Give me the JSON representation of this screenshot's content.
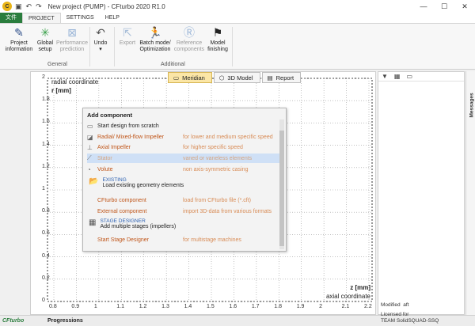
{
  "window": {
    "app_icon": "C",
    "title": "New project (PUMP) - CFturbo 2020 R1.0",
    "controls": [
      "minimize-icon",
      "maximize-icon",
      "close-icon"
    ]
  },
  "quick_access": [
    "save-icon",
    "undo-icon",
    "redo-icon"
  ],
  "ribbon_tabs": [
    "文件",
    "PROJECT",
    "SETTINGS",
    "HELP"
  ],
  "ribbon": {
    "project_information": "Project\ninformation",
    "global_setup": "Global\nsetup",
    "performance_prediction": "Performance\nprediction",
    "undo": "Undo",
    "export": "Export",
    "batch_mode": "Batch mode/\nOptimization",
    "reference_components": "Reference\ncomponents",
    "model_finishing": "Model\nfinishing",
    "group_general": "General",
    "group_additional": "Additional"
  },
  "view_tabs": [
    {
      "label": "Meridian",
      "icon": "meridian-icon",
      "active": true
    },
    {
      "label": "3D Model",
      "icon": "cube-icon",
      "active": false
    },
    {
      "label": "Report",
      "icon": "report-icon",
      "active": false
    }
  ],
  "plot": {
    "y_label": "radial coordinate",
    "y_unit": "r [mm]",
    "x_unit": "z [mm]",
    "x_label": "axial coordinate",
    "y_ticks": [
      "2",
      "1.8",
      "1.6",
      "1.4",
      "1.2",
      "1",
      "0.8",
      "0.6",
      "0.4",
      "0.2",
      "0"
    ],
    "x_ticks": [
      "0.8",
      "0.9",
      "1",
      "1.1",
      "1.2",
      "1.3",
      "1.4",
      "1.5",
      "1.6",
      "1.7",
      "1.8",
      "1.9",
      "2",
      "2.1",
      "2.2"
    ]
  },
  "popup": {
    "title": "Add component",
    "start_scratch": "Start design from scratch",
    "items": [
      {
        "name": "Radial/ Mixed-flow Impeller",
        "desc": "for lower and medium specific speed",
        "icon": "radial-impeller-icon"
      },
      {
        "name": "Axial Impeller",
        "desc": "for higher specific speed",
        "icon": "axial-impeller-icon"
      },
      {
        "name": "Stator",
        "desc": "vaned or vaneless elements",
        "icon": "stator-icon",
        "selected": true
      },
      {
        "name": "Volute",
        "desc": "non axis-symmetric casing",
        "icon": "volute-icon"
      }
    ],
    "existing_header": "EXISTING",
    "existing_text": "Load existing geometry elements",
    "existing_items": [
      {
        "name": "CFturbo component",
        "desc": "load from CFturbo file (*.cft)"
      },
      {
        "name": "External component",
        "desc": "import 3D-data from various formats"
      }
    ],
    "stage_header": "STAGE DESIGNER",
    "stage_text": "Add multiple stages (impellers)",
    "stage_item": {
      "name": "Start Stage Designer",
      "desc": "for multistage machines"
    }
  },
  "side_panel": {
    "tools": [
      "filter-icon",
      "grid-icon",
      "edit-icon"
    ],
    "modified": "Modified",
    "modified_value": "aft",
    "licensed_label": "Licensed for",
    "licensed_to": "TEAM SolidSQUAD-SSQ"
  },
  "messages_label": "Messages",
  "status": {
    "brand": "CFturbo",
    "progressions": "Progressions"
  },
  "colors": {
    "file_tab": "#2a7d3d",
    "active_view_tab": "#fbe6a6",
    "selected_row": "#cfe0f6",
    "item_text": "#c0561a"
  }
}
